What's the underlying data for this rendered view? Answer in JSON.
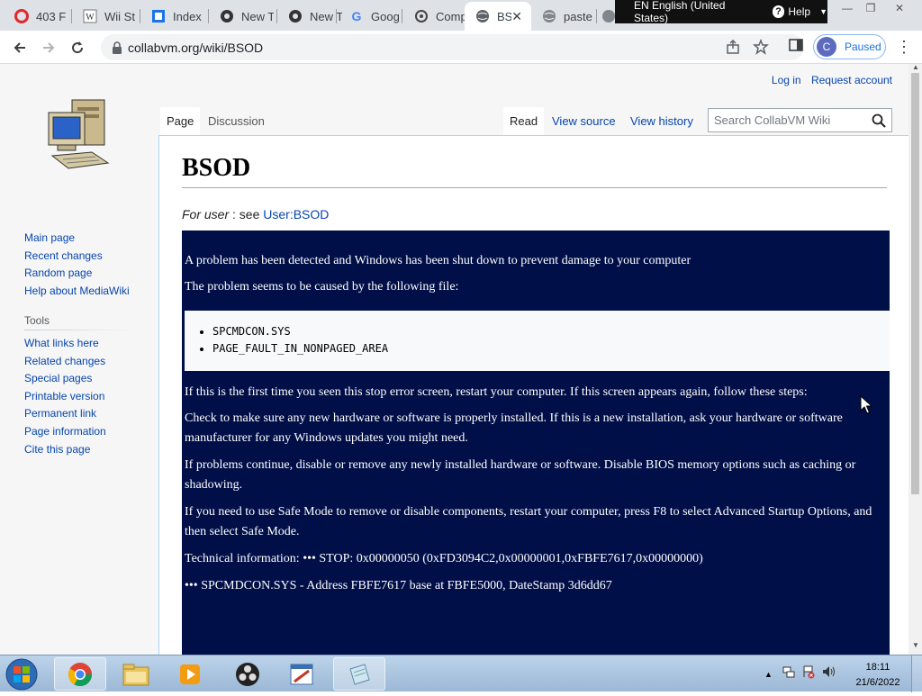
{
  "browser": {
    "tabs": [
      {
        "title": "403 F",
        "icon": "opera-icon"
      },
      {
        "title": "Wii St",
        "icon": "wiki-icon"
      },
      {
        "title": "Index",
        "icon": "index-icon"
      },
      {
        "title": "New T",
        "icon": "github-icon"
      },
      {
        "title": "New T",
        "icon": "github-icon"
      },
      {
        "title": "Googl",
        "icon": "google-icon"
      },
      {
        "title": "Comp",
        "icon": "computer-icon"
      },
      {
        "title": "BS",
        "icon": "globe-icon",
        "active": true
      },
      {
        "title": "paste",
        "icon": "globe-icon"
      }
    ],
    "language_bar": {
      "language": "EN English (United States)",
      "help": "Help"
    },
    "url": "collabvm.org/wiki/BSOD",
    "profile": {
      "initial": "C",
      "label": "Paused"
    }
  },
  "wiki": {
    "personal": {
      "login": "Log in",
      "request": "Request account"
    },
    "navigation": [
      "Main page",
      "Recent changes",
      "Random page",
      "Help about MediaWiki"
    ],
    "tools_heading": "Tools",
    "tools": [
      "What links here",
      "Related changes",
      "Special pages",
      "Printable version",
      "Permanent link",
      "Page information",
      "Cite this page"
    ],
    "tabs": {
      "page": "Page",
      "discussion": "Discussion",
      "read": "Read",
      "view_source": "View source",
      "view_history": "View history"
    },
    "search_placeholder": "Search CollabVM Wiki",
    "title": "BSOD",
    "hatnote": {
      "italic": "For user",
      "sep": ": see",
      "link": "User:BSOD"
    },
    "bsod": {
      "line1": "A problem has been detected and Windows has been shut down to prevent damage to your computer",
      "line2": "The problem seems to be caused by the following file:",
      "files": [
        "SPCMDCON.SYS",
        "PAGE_FAULT_IN_NONPAGED_AREA"
      ],
      "line3": "If this is the first time you seen this stop error screen, restart your computer. If this screen appears again, follow these steps:",
      "line4": "Check to make sure any new hardware or software is properly installed. If this is a new installation, ask your hardware or software manufacturer for any Windows updates you might need.",
      "line5": "If problems continue, disable or remove any newly installed hardware or software. Disable BIOS memory options such as caching or shadowing.",
      "line6": "If you need to use Safe Mode to remove or disable components, restart your computer, press F8 to select Advanced Startup Options, and then select Safe Mode.",
      "line7": "Technical information: ••• STOP: 0x00000050 (0xFD3094C2,0x00000001,0xFBFE7617,0x00000000)",
      "line8": "••• SPCMDCON.SYS - Address FBFE7617 base at FBFE5000, DateStamp 3d6dd67"
    }
  },
  "taskbar": {
    "apps": [
      "chrome-icon",
      "explorer-icon",
      "media-player-icon",
      "obs-icon",
      "paint-icon",
      "notepad-icon"
    ],
    "time": "18:11",
    "date": "21/6/2022"
  },
  "colors": {
    "bsod_bg": "#000f48",
    "link": "#0645ad",
    "chrome_tabstrip": "#dee1e6"
  }
}
